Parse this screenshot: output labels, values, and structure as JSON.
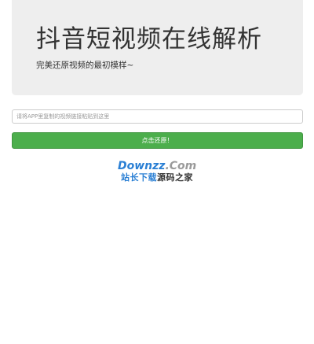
{
  "header": {
    "title": "抖音短视频在线解析",
    "subtitle": "完美还原视频的最初模样~"
  },
  "form": {
    "url_placeholder": "请将APP里复制的视频链接粘贴到这里",
    "submit_label": "点击还原！"
  },
  "watermark": {
    "domain_part1": "Downzz",
    "domain_part2": ".Com",
    "tagline_part1": "站长下载",
    "tagline_part2": "源码之家"
  },
  "colors": {
    "jumbotron_bg": "#eeeeee",
    "button_green": "#4cae4c",
    "watermark_blue": "#2a7fd4"
  }
}
